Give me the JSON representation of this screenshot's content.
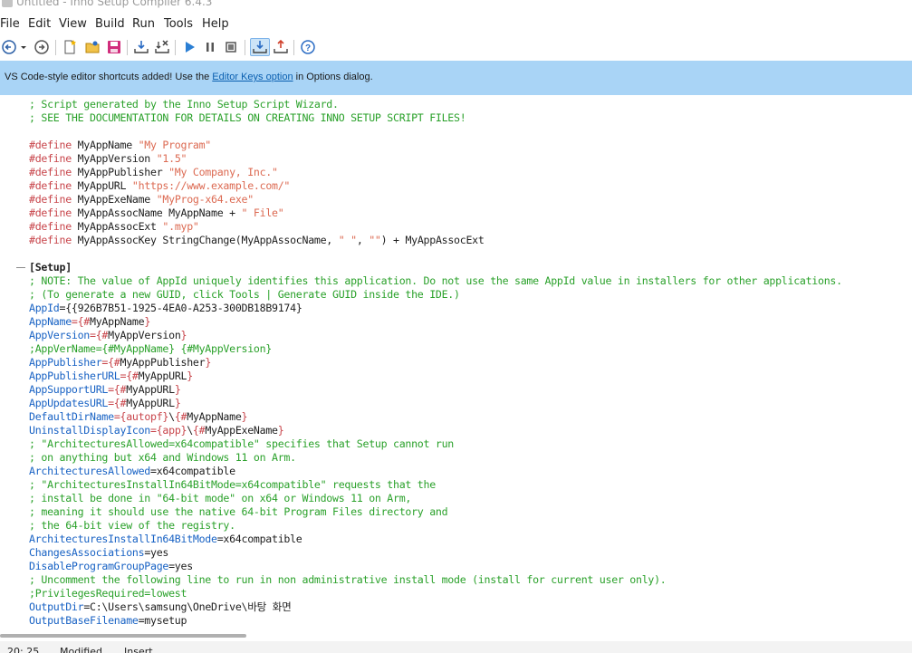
{
  "window": {
    "title": "Untitled - Inno Setup Compiler 6.4.3"
  },
  "menu": [
    "File",
    "Edit",
    "View",
    "Build",
    "Run",
    "Tools",
    "Help"
  ],
  "toolbar": {
    "icons": [
      "back-icon",
      "dropdown-icon",
      "forward-icon",
      "new-file-icon",
      "open-folder-icon",
      "save-icon",
      "compile-icon",
      "stop-compile-icon",
      "run-icon",
      "pause-icon",
      "stop-icon",
      "target-install-icon",
      "target-uninstall-icon",
      "help-icon"
    ]
  },
  "notice": {
    "prefix": "VS Code-style editor shortcuts added! Use the ",
    "link": "Editor Keys option",
    "suffix": " in Options dialog."
  },
  "editor": {
    "lines": [
      [
        [
          "comment",
          "; Script generated by the Inno Setup Script Wizard."
        ]
      ],
      [
        [
          "comment",
          "; SEE THE DOCUMENTATION FOR DETAILS ON CREATING INNO SETUP SCRIPT FILES!"
        ]
      ],
      [],
      [
        [
          "directive",
          "#define"
        ],
        [
          "ident",
          " MyAppName "
        ],
        [
          "str",
          "\"My Program\""
        ]
      ],
      [
        [
          "directive",
          "#define"
        ],
        [
          "ident",
          " MyAppVersion "
        ],
        [
          "str",
          "\"1.5\""
        ]
      ],
      [
        [
          "directive",
          "#define"
        ],
        [
          "ident",
          " MyAppPublisher "
        ],
        [
          "str",
          "\"My Company, Inc.\""
        ]
      ],
      [
        [
          "directive",
          "#define"
        ],
        [
          "ident",
          " MyAppURL "
        ],
        [
          "str",
          "\"https://www.example.com/\""
        ]
      ],
      [
        [
          "directive",
          "#define"
        ],
        [
          "ident",
          " MyAppExeName "
        ],
        [
          "str",
          "\"MyProg-x64.exe\""
        ]
      ],
      [
        [
          "directive",
          "#define"
        ],
        [
          "ident",
          " MyAppAssocName MyAppName + "
        ],
        [
          "str",
          "\" File\""
        ]
      ],
      [
        [
          "directive",
          "#define"
        ],
        [
          "ident",
          " MyAppAssocExt "
        ],
        [
          "str",
          "\".myp\""
        ]
      ],
      [
        [
          "directive",
          "#define"
        ],
        [
          "ident",
          " MyAppAssocKey StringChange(MyAppAssocName, "
        ],
        [
          "str",
          "\" \""
        ],
        [
          "ident",
          ", "
        ],
        [
          "str",
          "\"\""
        ],
        [
          "ident",
          ") + MyAppAssocExt"
        ]
      ],
      [],
      [
        [
          "section",
          "[Setup]"
        ]
      ],
      [
        [
          "comment",
          "; NOTE: The value of AppId uniquely identifies this application. Do not use the same AppId value in installers for other applications."
        ]
      ],
      [
        [
          "comment",
          "; (To generate a new GUID, click Tools | Generate GUID inside the IDE.)"
        ]
      ],
      [
        [
          "key",
          "AppId"
        ],
        [
          "val",
          "={{926B7B51-1925-4EA0-A253-300DB18B9174}"
        ]
      ],
      [
        [
          "key",
          "AppName"
        ],
        [
          "const",
          "={#"
        ],
        [
          "val",
          "MyAppName"
        ],
        [
          "const",
          "}"
        ]
      ],
      [
        [
          "key",
          "AppVersion"
        ],
        [
          "const",
          "={#"
        ],
        [
          "val",
          "MyAppVersion"
        ],
        [
          "const",
          "}"
        ]
      ],
      [
        [
          "comment",
          ";AppVerName={#MyAppName} {#MyAppVersion}"
        ]
      ],
      [
        [
          "key",
          "AppPublisher"
        ],
        [
          "const",
          "={#"
        ],
        [
          "val",
          "MyAppPublisher"
        ],
        [
          "const",
          "}"
        ]
      ],
      [
        [
          "key",
          "AppPublisherURL"
        ],
        [
          "const",
          "={#"
        ],
        [
          "val",
          "MyAppURL"
        ],
        [
          "const",
          "}"
        ]
      ],
      [
        [
          "key",
          "AppSupportURL"
        ],
        [
          "const",
          "={#"
        ],
        [
          "val",
          "MyAppURL"
        ],
        [
          "const",
          "}"
        ]
      ],
      [
        [
          "key",
          "AppUpdatesURL"
        ],
        [
          "const",
          "={#"
        ],
        [
          "val",
          "MyAppURL"
        ],
        [
          "const",
          "}"
        ]
      ],
      [
        [
          "key",
          "DefaultDirName"
        ],
        [
          "const",
          "={autopf}"
        ],
        [
          "val",
          "\\"
        ],
        [
          "const",
          "{#"
        ],
        [
          "val",
          "MyAppName"
        ],
        [
          "const",
          "}"
        ]
      ],
      [
        [
          "key",
          "UninstallDisplayIcon"
        ],
        [
          "const",
          "={app}"
        ],
        [
          "val",
          "\\"
        ],
        [
          "const",
          "{#"
        ],
        [
          "val",
          "MyAppExeName"
        ],
        [
          "const",
          "}"
        ]
      ],
      [
        [
          "comment",
          "; \"ArchitecturesAllowed=x64compatible\" specifies that Setup cannot run"
        ]
      ],
      [
        [
          "comment",
          "; on anything but x64 and Windows 11 on Arm."
        ]
      ],
      [
        [
          "key",
          "ArchitecturesAllowed"
        ],
        [
          "val",
          "=x64compatible"
        ]
      ],
      [
        [
          "comment",
          "; \"ArchitecturesInstallIn64BitMode=x64compatible\" requests that the"
        ]
      ],
      [
        [
          "comment",
          "; install be done in \"64-bit mode\" on x64 or Windows 11 on Arm,"
        ]
      ],
      [
        [
          "comment",
          "; meaning it should use the native 64-bit Program Files directory and"
        ]
      ],
      [
        [
          "comment",
          "; the 64-bit view of the registry."
        ]
      ],
      [
        [
          "key",
          "ArchitecturesInstallIn64BitMode"
        ],
        [
          "val",
          "=x64compatible"
        ]
      ],
      [
        [
          "key",
          "ChangesAssociations"
        ],
        [
          "val",
          "=yes"
        ]
      ],
      [
        [
          "key",
          "DisableProgramGroupPage"
        ],
        [
          "val",
          "=yes"
        ]
      ],
      [
        [
          "comment",
          "; Uncomment the following line to run in non administrative install mode (install for current user only)."
        ]
      ],
      [
        [
          "comment",
          ";PrivilegesRequired=lowest"
        ]
      ],
      [
        [
          "key",
          "OutputDir"
        ],
        [
          "val",
          "=C:\\Users\\samsung\\OneDrive\\바탕 화면"
        ]
      ],
      [
        [
          "key",
          "OutputBaseFilename"
        ],
        [
          "val",
          "=mysetup"
        ]
      ]
    ]
  },
  "status": {
    "position": "20: 25",
    "modified": "Modified",
    "mode": "Insert"
  }
}
